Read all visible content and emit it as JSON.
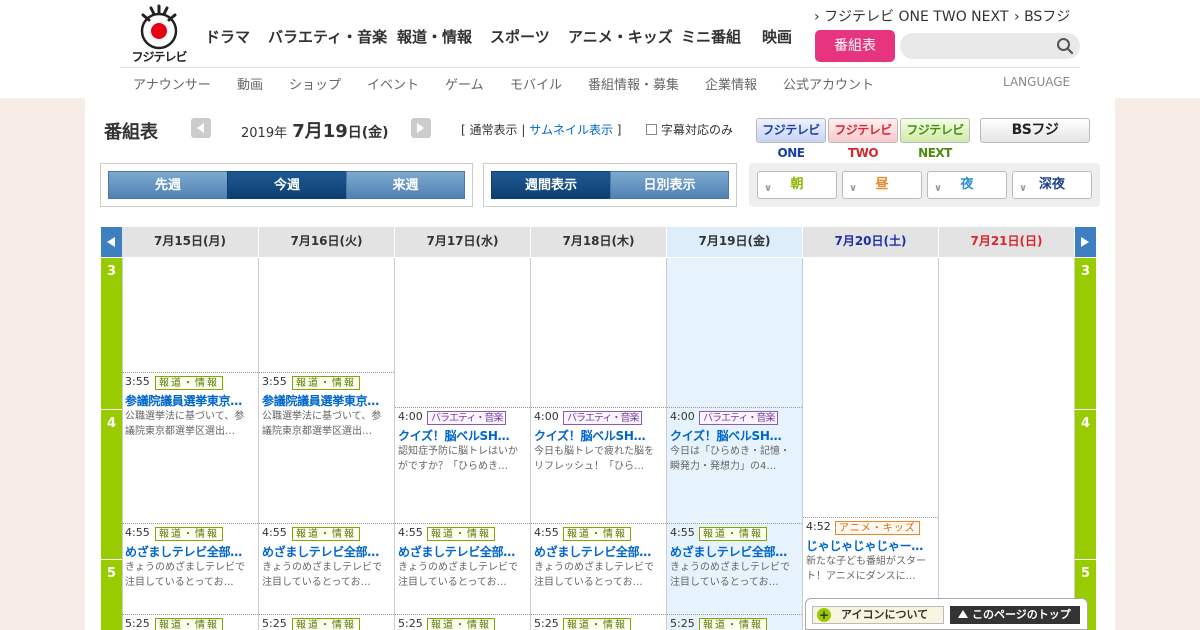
{
  "header": {
    "logo_text": "フジテレビ",
    "top_links": [
      "フジテレビ ONE TWO NEXT",
      "BSフジ"
    ],
    "global_nav": [
      "ドラマ",
      "バラエティ・音楽",
      "報道・情報",
      "スポーツ",
      "アニメ・キッズ",
      "ミニ番組",
      "映画"
    ],
    "schedule_button": "番組表",
    "search_placeholder": "",
    "sub_nav": [
      "アナウンサー",
      "動画",
      "ショップ",
      "イベント",
      "ゲーム",
      "モバイル",
      "番組情報・募集",
      "企業情報",
      "公式アカウント"
    ],
    "language": "LANGUAGE"
  },
  "toolbar": {
    "title": "番組表",
    "date": {
      "year": "2019",
      "year_suffix": "年",
      "month_day": "7月19",
      "day_suffix": "日",
      "weekday": "(金)"
    },
    "view_open": "[ ",
    "view_normal": "通常表示",
    "view_sep": " | ",
    "view_thumb": "サムネイル表示",
    "view_close": " ]",
    "caption_label": "字幕対応のみ",
    "channels": [
      {
        "label": "フジテレビ ONE",
        "color": "#1a3fa0"
      },
      {
        "label": "フジテレビ TWO",
        "color": "#d8262e"
      },
      {
        "label": "フジテレビ NEXT",
        "color": "#6aa81e"
      },
      {
        "label": "BSフジ",
        "color": "#222222"
      }
    ]
  },
  "week_buttons": [
    "先週",
    "今週",
    "来週"
  ],
  "mode_buttons": [
    "週間表示",
    "日別表示"
  ],
  "time_bands": [
    {
      "label": "朝",
      "color": "#8cb800"
    },
    {
      "label": "昼",
      "color": "#e8872c"
    },
    {
      "label": "夜",
      "color": "#2a8fd6"
    },
    {
      "label": "深夜",
      "color": "#1d3f8c"
    }
  ],
  "days": [
    {
      "label": "7月15日(月)",
      "color": "#333333"
    },
    {
      "label": "7月16日(火)",
      "color": "#333333"
    },
    {
      "label": "7月17日(水)",
      "color": "#333333"
    },
    {
      "label": "7月18日(木)",
      "color": "#333333"
    },
    {
      "label": "7月19日(金)",
      "color": "#333333"
    },
    {
      "label": "7月20日(土)",
      "color": "#1f2fa8"
    },
    {
      "label": "7月21日(日)",
      "color": "#d8262e"
    }
  ],
  "hours": [
    "3",
    "4",
    "5"
  ],
  "programs": {
    "senkyo": {
      "time": "3:55",
      "genre": "報道・情報",
      "title": "参議院議員選挙東京…",
      "desc": "公職選挙法に基づいて、参議院東京都選挙区選出…"
    },
    "quiz1": {
      "time": "4:00",
      "genre": "バラエティ・音楽",
      "title": "クイズ！脳ベルSH…",
      "desc": "認知症予防に脳トレはいかがですか？「ひらめき…"
    },
    "quiz2": {
      "time": "4:00",
      "genre": "バラエティ・音楽",
      "title": "クイズ！脳ベルSH…",
      "desc": "今日も脳トレで疲れた脳をリフレッシュ！「ひら…"
    },
    "quiz3": {
      "time": "4:00",
      "genre": "バラエティ・音楽",
      "title": "クイズ！脳ベルSH…",
      "desc": "今日は「ひらめき・記憶・瞬発力・発想力」の4…"
    },
    "mezamashi": {
      "time": "4:55",
      "genre": "報道・情報",
      "title": "めざましテレビ全部…",
      "desc": "きょうのめざましテレビで注目しているとってお…"
    },
    "jaja": {
      "time": "4:52",
      "genre": "アニメ・キッズ",
      "title": "じゃじゃじゃじゃー…",
      "desc": "新たな子ども番組がスタート！アニメにダンスに…"
    },
    "next": {
      "time": "5:25",
      "genre": "報道・情報"
    }
  },
  "footer_buttons": {
    "icons": "アイコンについて",
    "top": "このページのトップ"
  }
}
